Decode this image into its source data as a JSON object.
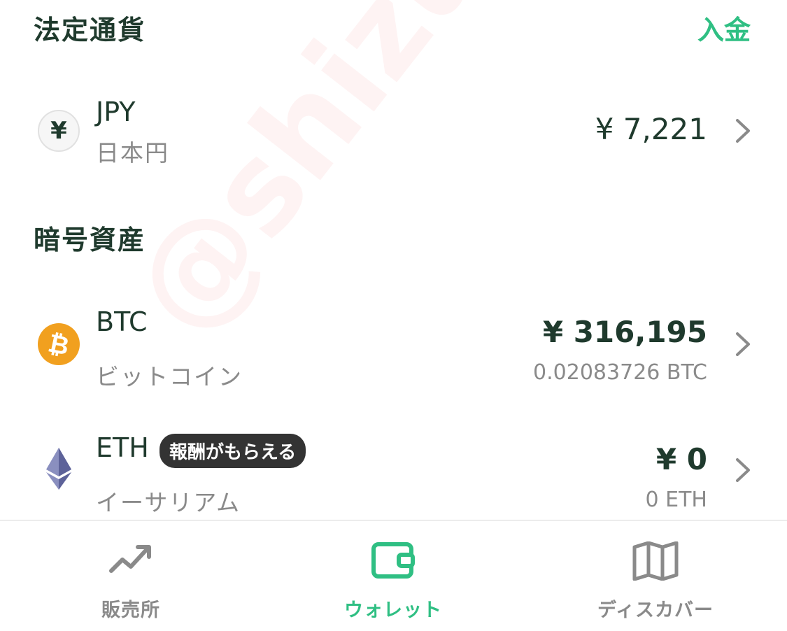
{
  "fiat_section": {
    "title": "法定通貨",
    "deposit_label": "入金"
  },
  "fiat_assets": [
    {
      "symbol": "JPY",
      "name": "日本円",
      "icon": "yen-icon",
      "icon_glyph": "¥",
      "amount": "¥ 7,221"
    }
  ],
  "crypto_section": {
    "title": "暗号資産"
  },
  "crypto_assets": [
    {
      "symbol": "BTC",
      "name": "ビットコイン",
      "icon": "bitcoin-icon",
      "amount": "¥ 316,195",
      "holding": "0.02083726 BTC",
      "icon_color": "#f1a01f"
    },
    {
      "symbol": "ETH",
      "name": "イーサリアム",
      "icon": "ethereum-icon",
      "badge": "報酬がもらえる",
      "amount": "¥ 0",
      "holding": "0 ETH"
    }
  ],
  "tabbar": {
    "tabs": [
      {
        "label": "販売所",
        "icon": "chart-trend-icon",
        "active": false
      },
      {
        "label": "ウォレット",
        "icon": "wallet-icon",
        "active": true
      },
      {
        "label": "ディスカバー",
        "icon": "map-icon",
        "active": false
      }
    ],
    "active_color": "#2fbf83",
    "inactive_color": "#8a8a8a"
  },
  "watermark": "@shizulog",
  "colors": {
    "accent": "#2fbf83",
    "text_primary": "#1f3a2d",
    "text_secondary": "#8a8a8a"
  }
}
